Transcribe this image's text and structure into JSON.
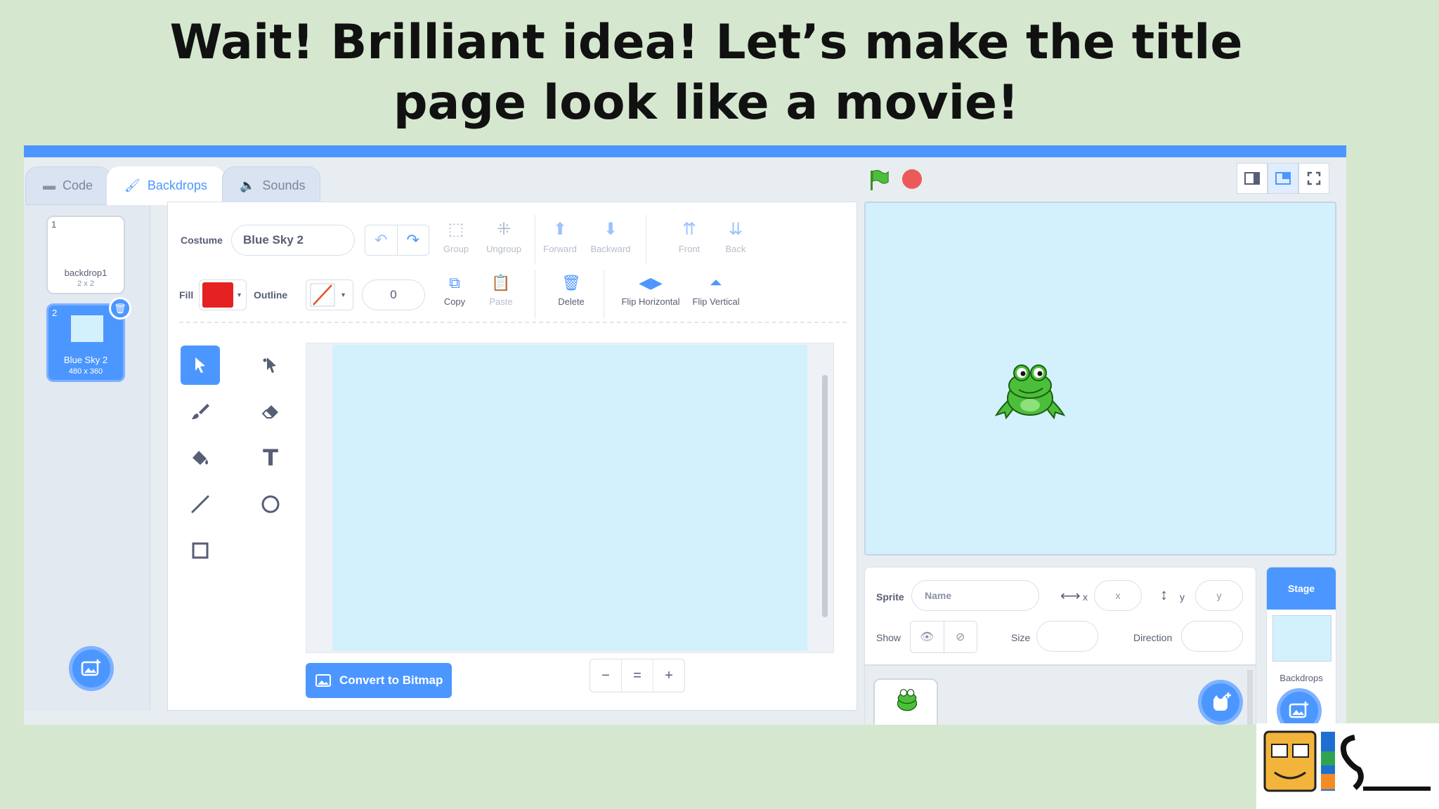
{
  "slide": {
    "title_line1": "Wait! Brilliant idea! Let’s make the title",
    "title_line2": "page look like a movie!"
  },
  "tabs": {
    "code": "Code",
    "backdrops": "Backdrops",
    "sounds": "Sounds"
  },
  "costumes": [
    {
      "num": "1",
      "name": "backdrop1",
      "size": "2 x 2"
    },
    {
      "num": "2",
      "name": "Blue Sky 2",
      "size": "480 x 360"
    }
  ],
  "editor": {
    "costume_label": "Costume",
    "costume_name": "Blue Sky 2",
    "fill_label": "Fill",
    "outline_label": "Outline",
    "outline_width": "0",
    "fill_color": "#e52222",
    "buttons_row1": {
      "group": "Group",
      "ungroup": "Ungroup",
      "forward": "Forward",
      "backward": "Backward",
      "front": "Front",
      "back": "Back"
    },
    "buttons_row2": {
      "copy": "Copy",
      "paste": "Paste",
      "delete": "Delete",
      "flip_h": "Flip Horizontal",
      "flip_v": "Flip Vertical"
    },
    "convert_label": "Convert to Bitmap",
    "zoom": {
      "out": "−",
      "reset": "=",
      "in": "+"
    }
  },
  "sprite_info": {
    "sprite_label": "Sprite",
    "name_placeholder": "Name",
    "x_label": "x",
    "x_placeholder": "x",
    "y_label": "y",
    "y_placeholder": "y",
    "show_label": "Show",
    "size_label": "Size",
    "direction_label": "Direction"
  },
  "stage_pane": {
    "title": "Stage",
    "backdrops_label": "Backdrops"
  },
  "colors": {
    "accent": "#4c97ff",
    "canvas": "#d3f1fd",
    "background": "#d5e8cf"
  }
}
